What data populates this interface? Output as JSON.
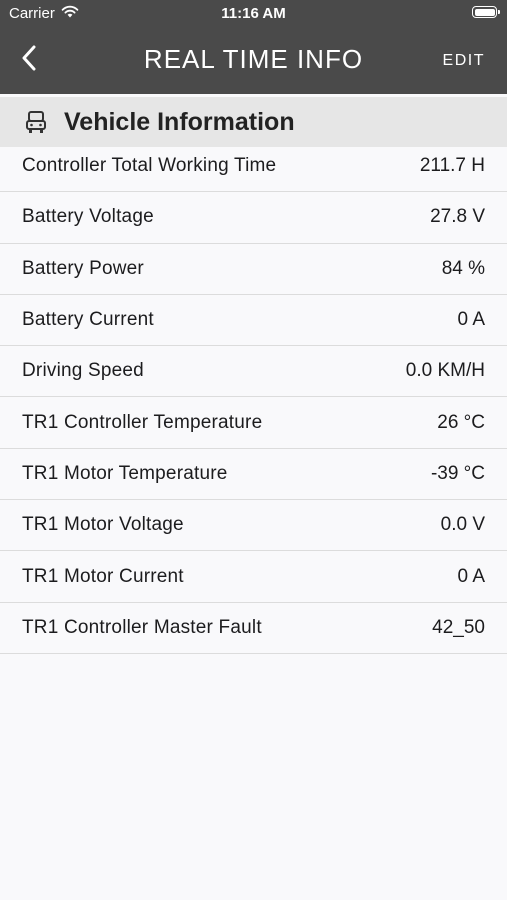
{
  "status_bar": {
    "carrier": "Carrier",
    "time": "11:16 AM"
  },
  "nav": {
    "title": "REAL TIME INFO",
    "edit_label": "EDIT"
  },
  "section": {
    "title": "Vehicle Information",
    "icon": "vehicle-icon"
  },
  "rows": [
    {
      "label": "Controller Total Working Time",
      "value": "211.7 H"
    },
    {
      "label": "Battery Voltage",
      "value": "27.8 V"
    },
    {
      "label": "Battery Power",
      "value": "84 %"
    },
    {
      "label": "Battery Current",
      "value": "0 A"
    },
    {
      "label": "Driving Speed",
      "value": "0.0 KM/H"
    },
    {
      "label": "TR1 Controller Temperature",
      "value": "26 °C"
    },
    {
      "label": "TR1 Motor Temperature",
      "value": "-39 °C"
    },
    {
      "label": "TR1 Motor Voltage",
      "value": "0.0 V"
    },
    {
      "label": "TR1 Motor Current",
      "value": "0 A"
    },
    {
      "label": "TR1 Controller Master Fault",
      "value": "42_50"
    }
  ],
  "colors": {
    "nav_background": "#4a4a4a",
    "section_background": "#e6e6e6",
    "page_background": "#f9f9fb"
  }
}
